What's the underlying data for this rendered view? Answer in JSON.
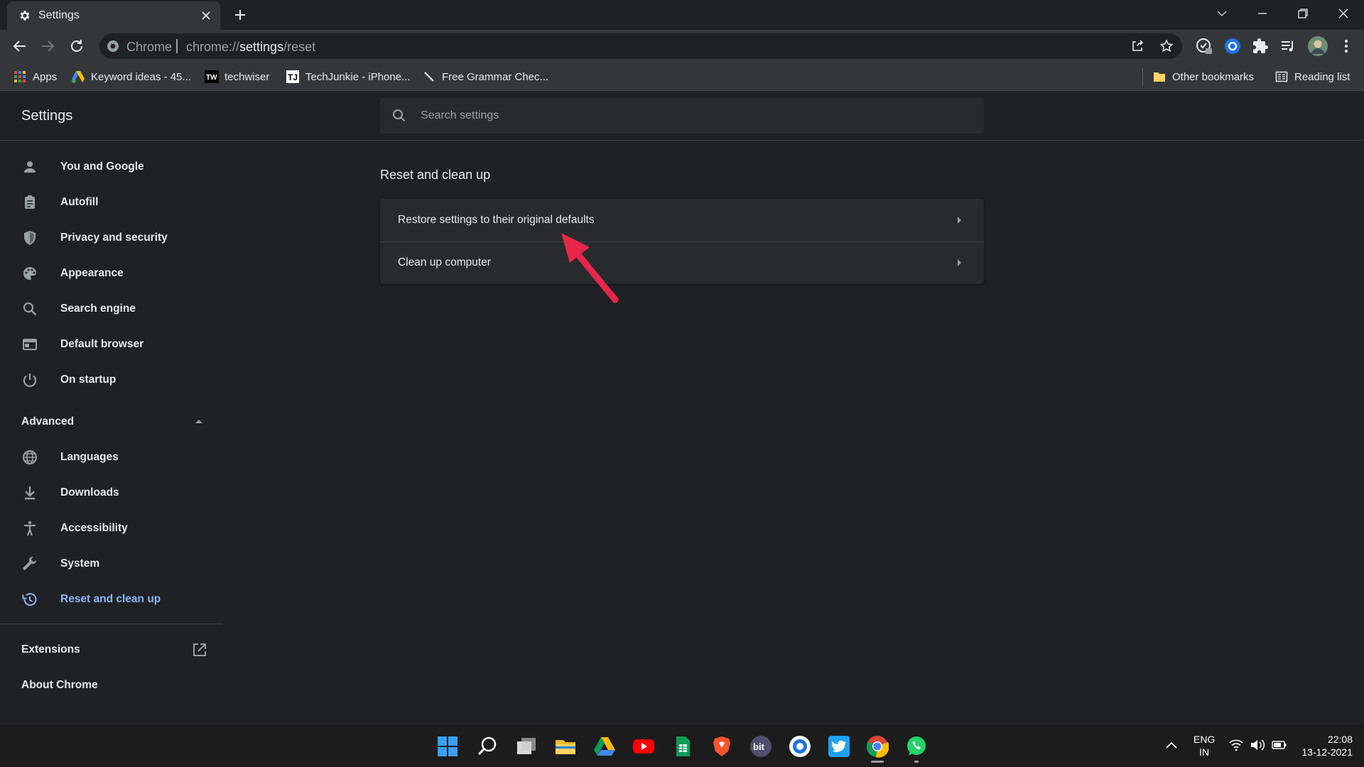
{
  "browser": {
    "tab_title": "Settings",
    "omnibox_scheme_label": "Chrome",
    "url_prefix": "chrome://",
    "url_path": "settings",
    "url_suffix": "/reset"
  },
  "bookmarks": {
    "apps": "Apps",
    "items": [
      {
        "label": "Keyword ideas - 45...",
        "icon": "google-ads-icon"
      },
      {
        "label": "techwiser",
        "icon": "techwiser-icon"
      },
      {
        "label": "TechJunkie - iPhone...",
        "icon": "techjunkie-icon"
      },
      {
        "label": "Free Grammar Chec...",
        "icon": "pen-icon"
      }
    ],
    "other": "Other bookmarks",
    "reading_list": "Reading list"
  },
  "settings": {
    "title": "Settings",
    "search_placeholder": "Search settings",
    "nav": [
      {
        "label": "You and Google",
        "icon": "person-icon"
      },
      {
        "label": "Autofill",
        "icon": "clipboard-icon"
      },
      {
        "label": "Privacy and security",
        "icon": "shield-icon"
      },
      {
        "label": "Appearance",
        "icon": "palette-icon"
      },
      {
        "label": "Search engine",
        "icon": "search-icon"
      },
      {
        "label": "Default browser",
        "icon": "browser-icon"
      },
      {
        "label": "On startup",
        "icon": "power-icon"
      }
    ],
    "advanced_label": "Advanced",
    "advanced_nav": [
      {
        "label": "Languages",
        "icon": "globe-icon"
      },
      {
        "label": "Downloads",
        "icon": "download-icon"
      },
      {
        "label": "Accessibility",
        "icon": "accessibility-icon"
      },
      {
        "label": "System",
        "icon": "wrench-icon"
      },
      {
        "label": "Reset and clean up",
        "icon": "history-icon",
        "active": true
      }
    ],
    "extensions_label": "Extensions",
    "about_label": "About Chrome",
    "section_title": "Reset and clean up",
    "rows": [
      {
        "label": "Restore settings to their original defaults"
      },
      {
        "label": "Clean up computer"
      }
    ]
  },
  "taskbar": {
    "lang_line1": "ENG",
    "lang_line2": "IN",
    "time": "22:08",
    "date": "13-12-2021"
  },
  "colors": {
    "accent": "#8ab4f8",
    "annotation_arrow": "#e8254a"
  }
}
